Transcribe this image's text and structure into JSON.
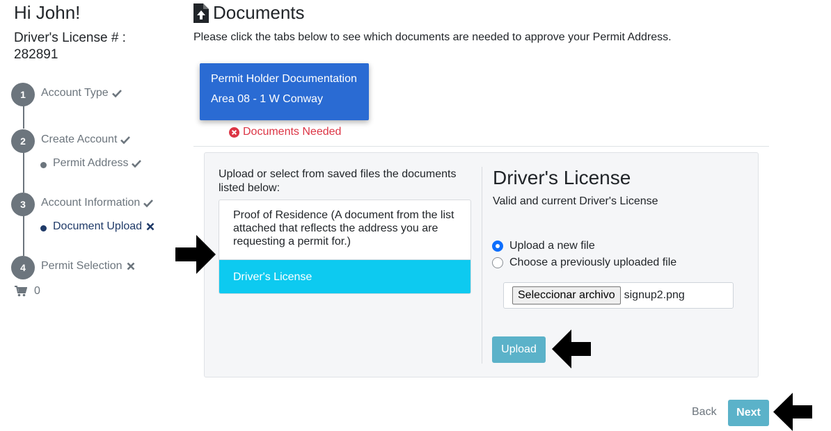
{
  "sidebar": {
    "greeting": "Hi John!",
    "license_label": "Driver's License # : 282891",
    "steps": [
      {
        "number": "1",
        "label": "Account Type",
        "status": "check"
      },
      {
        "number": "2",
        "label": "Create Account",
        "status": "check"
      },
      {
        "number": "3",
        "label": "Account Information",
        "status": "check"
      },
      {
        "number": "4",
        "label": "Permit Selection",
        "status": "x"
      }
    ],
    "substeps": [
      {
        "label": "Permit Address",
        "status": "check"
      },
      {
        "label": "Document Upload",
        "status": "x"
      }
    ],
    "cart_count": "0"
  },
  "main": {
    "title": "Documents",
    "intro": "Please click the tabs below to see which documents are needed to approve your Permit Address.",
    "tab": {
      "line1": "Permit Holder Documentation",
      "line2": "Area 08 - 1 W Conway"
    },
    "docs_needed": "Documents Needed",
    "upload_instructions": "Upload or select from saved files the documents listed below:",
    "documents": [
      "Proof of Residence (A document from the list attached that reflects the address you are requesting a permit for.)",
      "Driver's License"
    ],
    "selected_doc_title": "Driver's License",
    "selected_doc_sub": "Valid and current Driver's License",
    "radio_upload_new": "Upload a new file",
    "radio_choose_prev": "Choose a previously uploaded file",
    "file_button": "Seleccionar archivo",
    "file_name": "signup2.png",
    "upload_button": "Upload",
    "back_link": "Back",
    "next_button": "Next"
  },
  "colors": {
    "tab_blue": "#2a6bd3",
    "active_doc": "#0dcaf0",
    "button_teal": "#5bb2c9",
    "danger": "#dc3545",
    "step_gray": "#6c757d"
  }
}
